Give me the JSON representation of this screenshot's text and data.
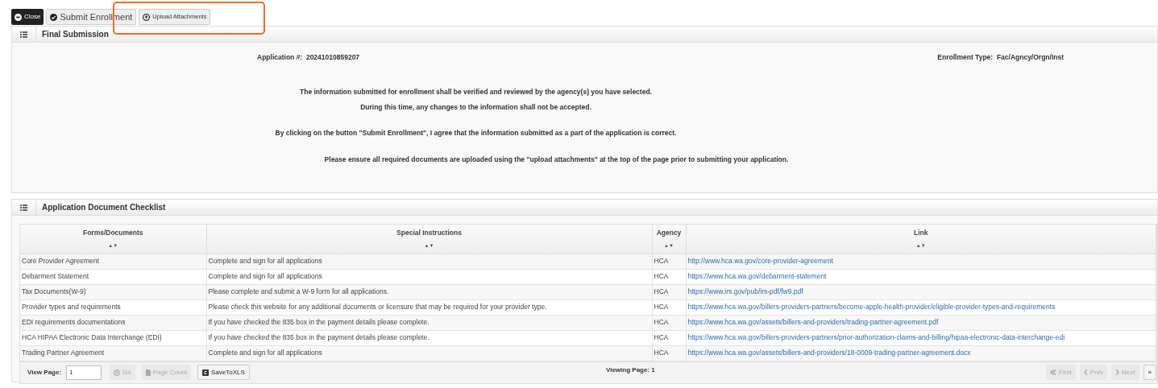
{
  "toolbar": [
    {
      "kind": "close",
      "label": "Close"
    },
    {
      "kind": "submit",
      "label": "Submit Enrollment"
    },
    {
      "kind": "upload",
      "label": "Upload Attachments"
    }
  ],
  "final_submission": {
    "title": "Final Submission",
    "application_label": "Application #:",
    "application_number": "20241010859207",
    "enrollment_type_label": "Enrollment Type:",
    "enrollment_type": "Fac/Agncy/Orgn/Inst",
    "paragraphs": [
      [
        "The information submitted for enrollment shall be verified and reviewed by the agency(s) you have selected.",
        "During this time, any changes to the information shall not be accepted."
      ],
      [
        "By clicking on the button \"Submit Enrollment\", I agree that the information submitted as a part of the application is correct."
      ],
      [
        "Please ensure all required documents are uploaded using the \"upload attachments\" at the top of the page prior to submitting your application."
      ]
    ]
  },
  "checklist": {
    "title": "Application Document Checklist",
    "sort_glyph": "▲▼",
    "columns": [
      "Forms/Documents",
      "Special Instructions",
      "Agency",
      "Link"
    ],
    "rows": [
      [
        "Core Provider Agreement",
        "Complete and sign for all applications",
        "HCA",
        "http://www.hca.wa.gov/core-provider-agreement"
      ],
      [
        "Debarment Statement",
        "Complete and sign for all applications",
        "HCA",
        "https://www.hca.wa.gov/debarment-statement"
      ],
      [
        "Tax Documents(W-9)",
        "Please complete and submit a W-9 form for all applications.",
        "HCA",
        "https://www.irs.gov/pub/irs-pdf/fw9.pdf"
      ],
      [
        "Provider types and requirements",
        "Please check this website for any additional documents or licensure that may be required for your provider type.",
        "HCA",
        "https://www.hca.wa.gov/billers-providers-partners/become-apple-health-provider/eligible-provider-types-and-requirements"
      ],
      [
        "EDI requirements documentations",
        "If you have checked the 835 box in the payment details please complete.",
        "HCA",
        "https://www.hca.wa.gov/assets/billers-and-providers/trading-partner-agreement.pdf"
      ],
      [
        "HCA HIPAA Electronic Data Interchange (EDI)",
        "If you have checked the 835 box in the payment details please complete.",
        "HCA",
        "https://www.hca.wa.gov/billers-providers-partners/prior-authorization-claims-and-billing/hipaa-electronic-data-interchange-edi"
      ],
      [
        "Trading Partner Agreement",
        "Complete and sign for all applications",
        "HCA",
        "https://www.hca.wa.gov/assets/billers-and-providers/18-0009-trading-partner-agreement.docx"
      ]
    ],
    "footer": {
      "view_page_label": "View Page:",
      "view_page_value": "1",
      "viewing_page": "Viewing Page: 1",
      "left_buttons": [
        {
          "kind": "go",
          "label": "Go",
          "disabled": true
        },
        {
          "kind": "count",
          "label": "Page Count",
          "disabled": true
        },
        {
          "kind": "xls",
          "label": "SaveToXLS",
          "disabled": false
        }
      ],
      "nav_buttons": [
        {
          "kind": "first",
          "label": "First",
          "disabled": true
        },
        {
          "kind": "prev",
          "label": "Prev",
          "disabled": true
        },
        {
          "kind": "next",
          "label": "Next",
          "disabled": true
        },
        {
          "kind": "last",
          "label": "»",
          "disabled": false
        }
      ]
    }
  }
}
